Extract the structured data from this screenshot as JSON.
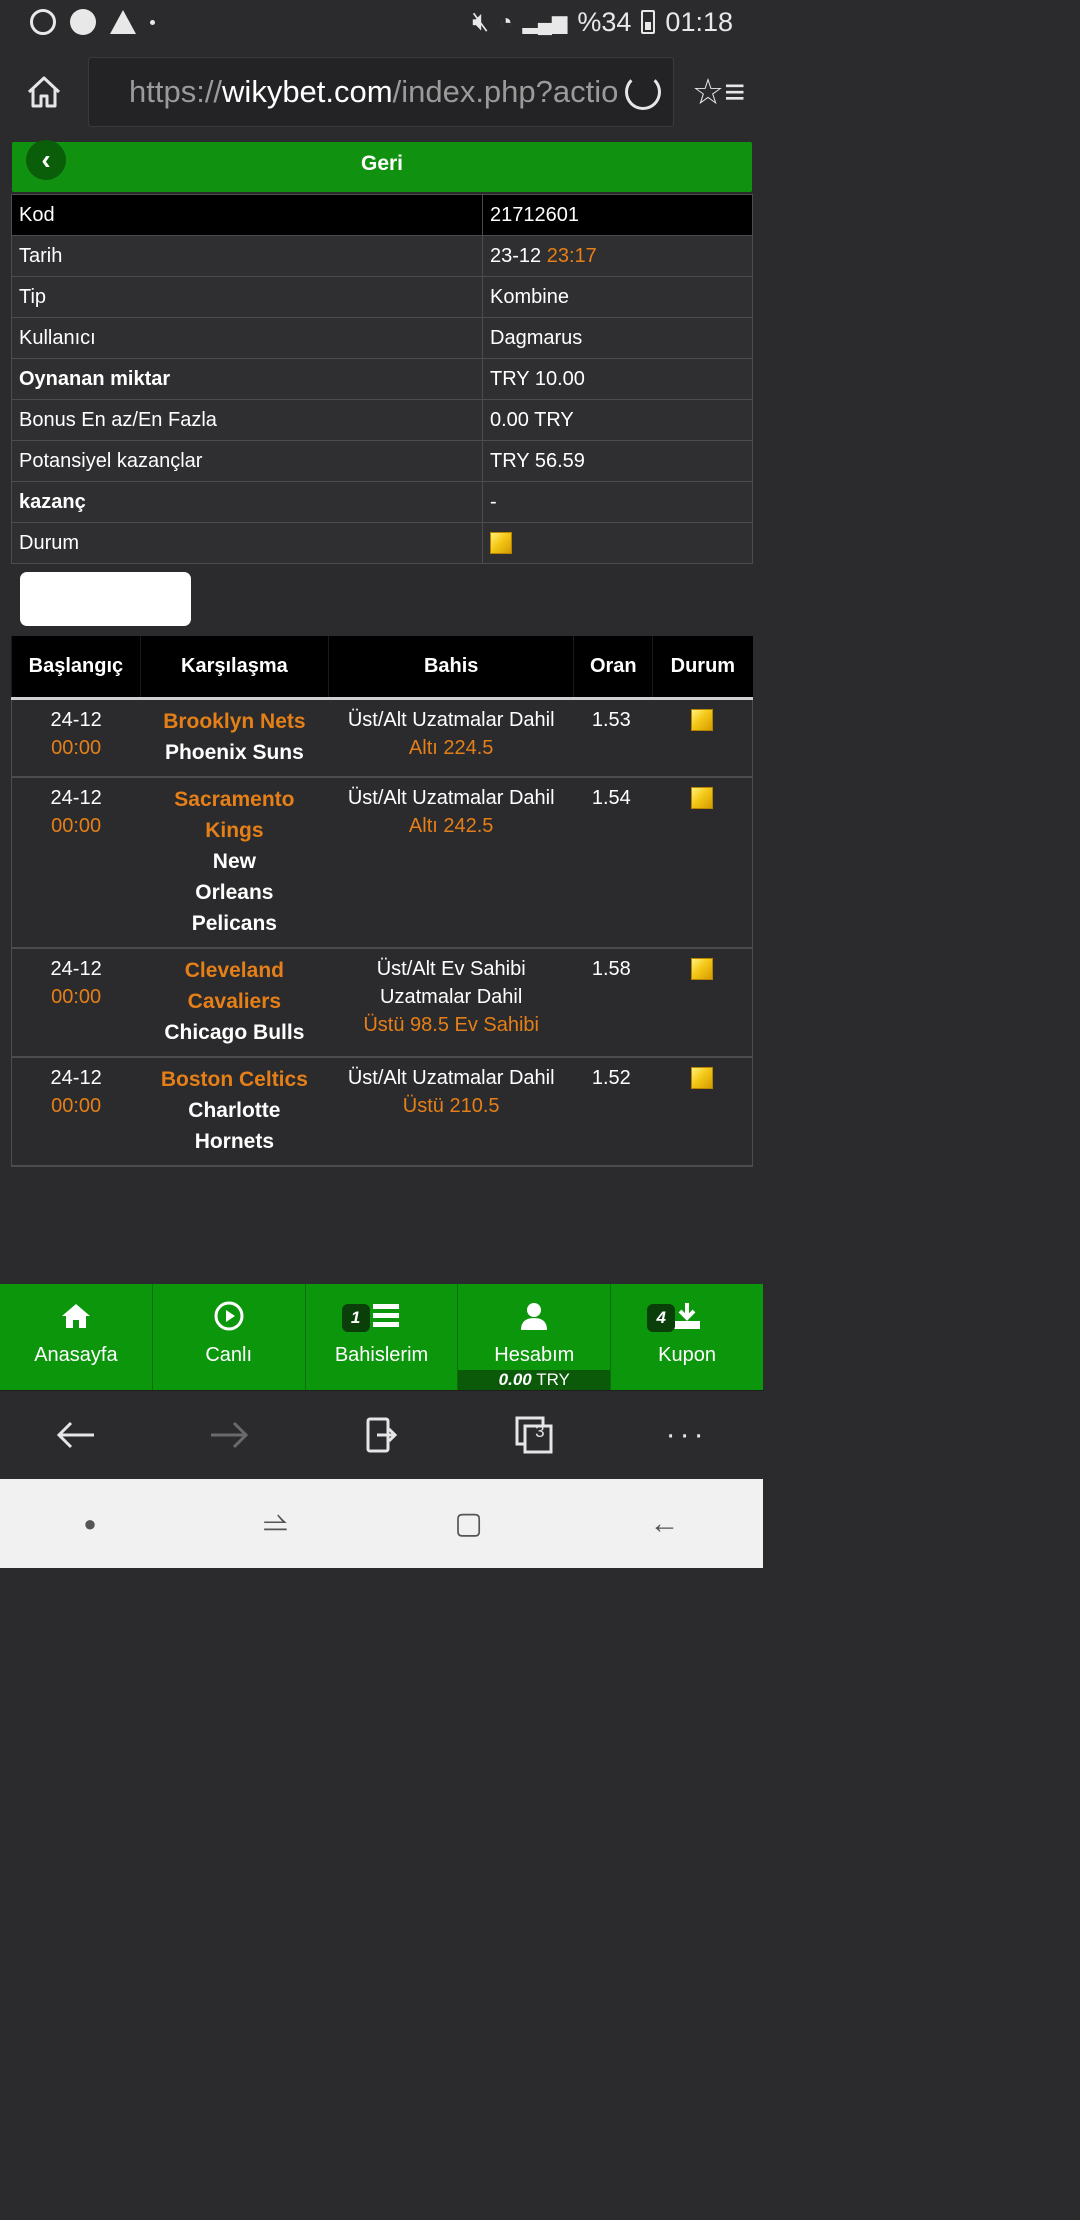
{
  "status_bar": {
    "battery": "%34",
    "time": "01:18"
  },
  "browser": {
    "url_prefix": "https://",
    "url_domain": "wikybet.com",
    "url_path": "/index.php?actio"
  },
  "header": {
    "back_title": "Geri"
  },
  "ticket": {
    "rows": [
      {
        "label": "Kod",
        "value": "21712601"
      },
      {
        "label": "Tarih",
        "value": "23-12",
        "value_time": "23:17"
      },
      {
        "label": "Tip",
        "value": "Kombine"
      },
      {
        "label": "Kullanıcı",
        "value": "Dagmarus"
      },
      {
        "label": "Oynanan miktar",
        "value": "TRY 10.00"
      },
      {
        "label": "Bonus En az/En Fazla",
        "value": "0.00 TRY"
      },
      {
        "label": "Potansiyel kazançlar",
        "value": "TRY 56.59"
      },
      {
        "label": "kazanç",
        "value": "-"
      },
      {
        "label": "Durum",
        "value": ""
      }
    ]
  },
  "bets": {
    "headers": [
      "Başlangıç",
      "Karşılaşma",
      "Bahis",
      "Oran",
      "Durum"
    ],
    "rows": [
      {
        "date": "24-12",
        "time": "00:00",
        "home": "Brooklyn Nets",
        "away": "Phoenix Suns",
        "market": "Üst/Alt Uzatmalar Dahil",
        "pick": "Altı 224.5",
        "odds": "1.53"
      },
      {
        "date": "24-12",
        "time": "00:00",
        "home": "Sacramento Kings",
        "away": "New Orleans Pelicans",
        "market": "Üst/Alt Uzatmalar Dahil",
        "pick": "Altı 242.5",
        "odds": "1.54"
      },
      {
        "date": "24-12",
        "time": "00:00",
        "home": "Cleveland Cavaliers",
        "away": "Chicago Bulls",
        "market": "Üst/Alt Ev Sahibi Uzatmalar Dahil",
        "pick": "Üstü 98.5 Ev Sahibi",
        "odds": "1.58"
      },
      {
        "date": "24-12",
        "time": "00:00",
        "home": "Boston Celtics",
        "away": "Charlotte Hornets",
        "market": "Üst/Alt Uzatmalar Dahil",
        "pick": "Üstü 210.5",
        "odds": "1.52"
      }
    ]
  },
  "app_nav": {
    "items": [
      {
        "label": "Anasayfa",
        "icon": "home-icon"
      },
      {
        "label": "Canlı",
        "icon": "play-circle-icon"
      },
      {
        "label": "Bahislerim",
        "icon": "list-icon",
        "badge": "1"
      },
      {
        "label": "Hesabım",
        "icon": "user-icon",
        "balance_amount": "0.00",
        "balance_currency": "TRY"
      },
      {
        "label": "Kupon",
        "icon": "download-icon",
        "badge": "4"
      }
    ]
  },
  "browser_toolbar": {
    "tabs_count": "3"
  },
  "colors": {
    "accent_green": "#0c960c",
    "highlight_orange": "#e57f17",
    "background": "#2b2b2d"
  }
}
